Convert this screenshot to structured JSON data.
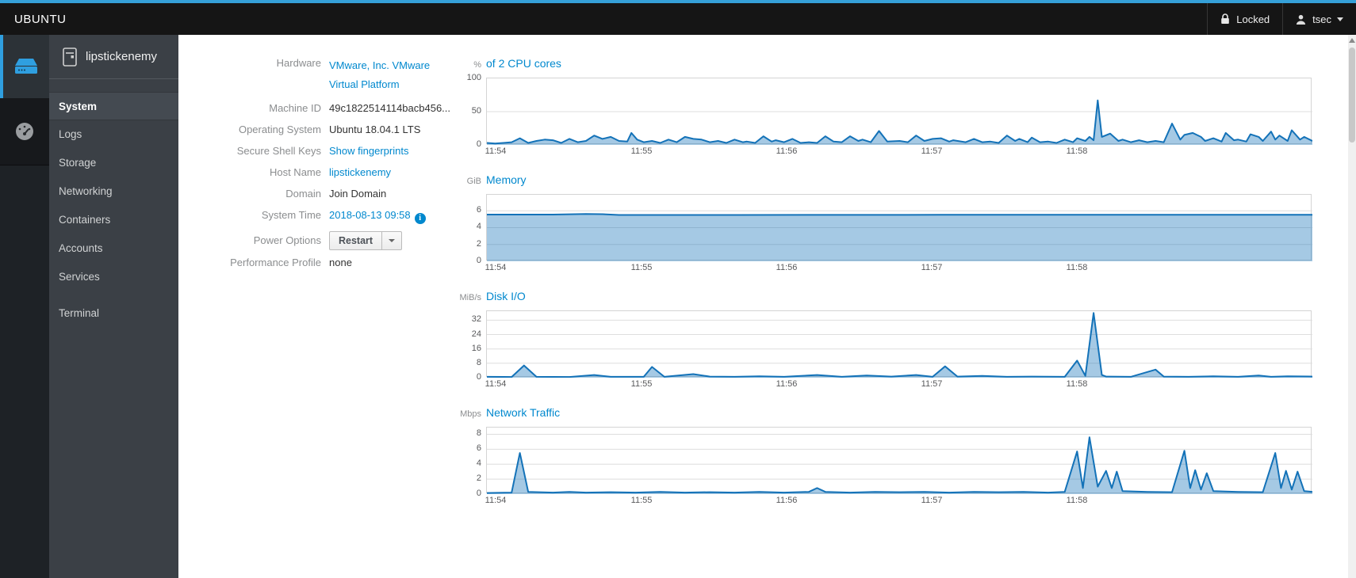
{
  "topbar": {
    "brand": "UBUNTU",
    "locked_label": "Locked",
    "user": "tsec"
  },
  "sidebar": {
    "host": "lipstickenemy",
    "items": [
      {
        "label": "System",
        "selected": true
      },
      {
        "label": "Logs",
        "selected": false
      },
      {
        "label": "Storage",
        "selected": false
      },
      {
        "label": "Networking",
        "selected": false
      },
      {
        "label": "Containers",
        "selected": false
      },
      {
        "label": "Accounts",
        "selected": false
      },
      {
        "label": "Services",
        "selected": false
      },
      {
        "label": "Terminal",
        "selected": false
      }
    ]
  },
  "info": {
    "hardware_label": "Hardware",
    "hardware_value": "VMware, Inc. VMware Virtual Platform",
    "machine_id_label": "Machine ID",
    "machine_id_value": "49c1822514114bacb456...",
    "os_label": "Operating System",
    "os_value": "Ubuntu 18.04.1 LTS",
    "ssh_label": "Secure Shell Keys",
    "ssh_value": "Show fingerprints",
    "hostname_label": "Host Name",
    "hostname_value": "lipstickenemy",
    "domain_label": "Domain",
    "domain_value": "Join Domain",
    "time_label": "System Time",
    "time_value": "2018-08-13 09:58",
    "power_label": "Power Options",
    "power_button": "Restart",
    "perf_label": "Performance Profile",
    "perf_value": "none"
  },
  "colors": {
    "accent_link": "#0088ce",
    "topbar_accent": "#35a0d8",
    "chart_line": "#1372b8",
    "chart_fill": "rgba(19,114,184,0.38)",
    "grid_line": "#dedede"
  },
  "chart_data": [
    {
      "type": "area",
      "title": "of 2 CPU cores",
      "unit": "%",
      "ylim": [
        0,
        100
      ],
      "yticks": [
        100,
        50,
        0
      ],
      "x_tick_labels": [
        "11:54",
        "11:55",
        "11:56",
        "11:57",
        "11:58"
      ],
      "x_tick_fracs": [
        0.012,
        0.188,
        0.364,
        0.54,
        0.716
      ],
      "grid": true,
      "legend": "none",
      "points": [
        [
          0,
          3
        ],
        [
          0.01,
          2
        ],
        [
          0.02,
          3
        ],
        [
          0.03,
          4
        ],
        [
          0.04,
          10
        ],
        [
          0.05,
          3
        ],
        [
          0.06,
          6
        ],
        [
          0.07,
          8
        ],
        [
          0.08,
          7
        ],
        [
          0.09,
          3
        ],
        [
          0.1,
          9
        ],
        [
          0.11,
          4
        ],
        [
          0.12,
          6
        ],
        [
          0.13,
          14
        ],
        [
          0.14,
          9
        ],
        [
          0.15,
          12
        ],
        [
          0.16,
          6
        ],
        [
          0.17,
          5
        ],
        [
          0.175,
          18
        ],
        [
          0.182,
          8
        ],
        [
          0.19,
          4
        ],
        [
          0.2,
          6
        ],
        [
          0.21,
          3
        ],
        [
          0.22,
          8
        ],
        [
          0.23,
          4
        ],
        [
          0.24,
          12
        ],
        [
          0.25,
          9
        ],
        [
          0.26,
          8
        ],
        [
          0.27,
          4
        ],
        [
          0.28,
          6
        ],
        [
          0.29,
          3
        ],
        [
          0.3,
          8
        ],
        [
          0.31,
          4
        ],
        [
          0.315,
          5
        ],
        [
          0.325,
          3
        ],
        [
          0.335,
          13
        ],
        [
          0.345,
          5
        ],
        [
          0.35,
          7
        ],
        [
          0.36,
          4
        ],
        [
          0.37,
          9
        ],
        [
          0.38,
          3
        ],
        [
          0.39,
          4
        ],
        [
          0.4,
          3
        ],
        [
          0.41,
          13
        ],
        [
          0.42,
          5
        ],
        [
          0.43,
          4
        ],
        [
          0.44,
          13
        ],
        [
          0.45,
          6
        ],
        [
          0.455,
          8
        ],
        [
          0.465,
          4
        ],
        [
          0.475,
          21
        ],
        [
          0.485,
          5
        ],
        [
          0.5,
          6
        ],
        [
          0.51,
          4
        ],
        [
          0.52,
          14
        ],
        [
          0.53,
          6
        ],
        [
          0.54,
          9
        ],
        [
          0.55,
          10
        ],
        [
          0.56,
          5
        ],
        [
          0.565,
          7
        ],
        [
          0.58,
          4
        ],
        [
          0.59,
          9
        ],
        [
          0.6,
          4
        ],
        [
          0.61,
          5
        ],
        [
          0.62,
          3
        ],
        [
          0.63,
          14
        ],
        [
          0.64,
          6
        ],
        [
          0.645,
          9
        ],
        [
          0.655,
          4
        ],
        [
          0.66,
          11
        ],
        [
          0.67,
          4
        ],
        [
          0.68,
          5
        ],
        [
          0.69,
          3
        ],
        [
          0.7,
          8
        ],
        [
          0.71,
          4
        ],
        [
          0.715,
          10
        ],
        [
          0.725,
          6
        ],
        [
          0.73,
          12
        ],
        [
          0.735,
          7
        ],
        [
          0.74,
          67
        ],
        [
          0.745,
          12
        ],
        [
          0.755,
          17
        ],
        [
          0.765,
          6
        ],
        [
          0.77,
          8
        ],
        [
          0.78,
          4
        ],
        [
          0.79,
          7
        ],
        [
          0.8,
          4
        ],
        [
          0.81,
          6
        ],
        [
          0.82,
          4
        ],
        [
          0.83,
          32
        ],
        [
          0.84,
          8
        ],
        [
          0.845,
          15
        ],
        [
          0.855,
          18
        ],
        [
          0.865,
          12
        ],
        [
          0.87,
          6
        ],
        [
          0.88,
          10
        ],
        [
          0.89,
          5
        ],
        [
          0.895,
          18
        ],
        [
          0.905,
          7
        ],
        [
          0.91,
          8
        ],
        [
          0.92,
          5
        ],
        [
          0.925,
          16
        ],
        [
          0.935,
          12
        ],
        [
          0.94,
          6
        ],
        [
          0.95,
          20
        ],
        [
          0.955,
          8
        ],
        [
          0.96,
          14
        ],
        [
          0.97,
          6
        ],
        [
          0.975,
          22
        ],
        [
          0.985,
          8
        ],
        [
          0.99,
          12
        ],
        [
          1,
          6
        ]
      ]
    },
    {
      "type": "area",
      "title": "Memory",
      "unit": "GiB",
      "ylim": [
        0,
        7.9
      ],
      "yticks": [
        6,
        4,
        2,
        0
      ],
      "x_tick_labels": [
        "11:54",
        "11:55",
        "11:56",
        "11:57",
        "11:58"
      ],
      "x_tick_fracs": [
        0.012,
        0.188,
        0.364,
        0.54,
        0.716
      ],
      "grid": true,
      "legend": "none",
      "points": [
        [
          0,
          5.55
        ],
        [
          0.08,
          5.55
        ],
        [
          0.12,
          5.62
        ],
        [
          0.14,
          5.6
        ],
        [
          0.16,
          5.5
        ],
        [
          0.3,
          5.5
        ],
        [
          0.55,
          5.52
        ],
        [
          0.8,
          5.53
        ],
        [
          1,
          5.53
        ]
      ]
    },
    {
      "type": "area",
      "title": "Disk I/O",
      "unit": "MiB/s",
      "ylim": [
        0,
        37
      ],
      "yticks": [
        32,
        24,
        16,
        8,
        0
      ],
      "x_tick_labels": [
        "11:54",
        "11:55",
        "11:56",
        "11:57",
        "11:58"
      ],
      "x_tick_fracs": [
        0.012,
        0.188,
        0.364,
        0.54,
        0.716
      ],
      "grid": true,
      "legend": "none",
      "points": [
        [
          0,
          0.5
        ],
        [
          0.03,
          0.4
        ],
        [
          0.045,
          6.8
        ],
        [
          0.06,
          0.5
        ],
        [
          0.1,
          0.4
        ],
        [
          0.13,
          1.5
        ],
        [
          0.15,
          0.5
        ],
        [
          0.19,
          0.5
        ],
        [
          0.2,
          6.0
        ],
        [
          0.215,
          0.5
        ],
        [
          0.25,
          2.0
        ],
        [
          0.27,
          0.6
        ],
        [
          0.3,
          0.5
        ],
        [
          0.33,
          0.8
        ],
        [
          0.36,
          0.5
        ],
        [
          0.4,
          1.5
        ],
        [
          0.43,
          0.5
        ],
        [
          0.46,
          1.2
        ],
        [
          0.49,
          0.6
        ],
        [
          0.52,
          1.5
        ],
        [
          0.54,
          0.5
        ],
        [
          0.555,
          6.3
        ],
        [
          0.57,
          0.6
        ],
        [
          0.6,
          1.0
        ],
        [
          0.63,
          0.5
        ],
        [
          0.66,
          0.6
        ],
        [
          0.7,
          0.5
        ],
        [
          0.715,
          9.5
        ],
        [
          0.725,
          1.0
        ],
        [
          0.735,
          36
        ],
        [
          0.745,
          1.5
        ],
        [
          0.75,
          0.6
        ],
        [
          0.78,
          0.5
        ],
        [
          0.81,
          4.5
        ],
        [
          0.82,
          0.6
        ],
        [
          0.85,
          0.5
        ],
        [
          0.88,
          0.8
        ],
        [
          0.91,
          0.5
        ],
        [
          0.935,
          1.2
        ],
        [
          0.95,
          0.5
        ],
        [
          0.97,
          0.8
        ],
        [
          1,
          0.6
        ]
      ]
    },
    {
      "type": "area",
      "title": "Network Traffic",
      "unit": "Mbps",
      "ylim": [
        0,
        8.9
      ],
      "yticks": [
        8,
        6,
        4,
        2,
        0
      ],
      "x_tick_labels": [
        "11:54",
        "11:55",
        "11:56",
        "11:57",
        "11:58"
      ],
      "x_tick_fracs": [
        0.012,
        0.188,
        0.364,
        0.54,
        0.716
      ],
      "grid": true,
      "legend": "none",
      "points": [
        [
          0,
          0.15
        ],
        [
          0.03,
          0.2
        ],
        [
          0.04,
          5.5
        ],
        [
          0.05,
          0.3
        ],
        [
          0.08,
          0.2
        ],
        [
          0.1,
          0.3
        ],
        [
          0.12,
          0.2
        ],
        [
          0.15,
          0.25
        ],
        [
          0.18,
          0.2
        ],
        [
          0.21,
          0.3
        ],
        [
          0.24,
          0.2
        ],
        [
          0.27,
          0.25
        ],
        [
          0.3,
          0.2
        ],
        [
          0.33,
          0.3
        ],
        [
          0.36,
          0.2
        ],
        [
          0.39,
          0.3
        ],
        [
          0.4,
          0.8
        ],
        [
          0.41,
          0.3
        ],
        [
          0.44,
          0.2
        ],
        [
          0.47,
          0.3
        ],
        [
          0.5,
          0.25
        ],
        [
          0.53,
          0.3
        ],
        [
          0.56,
          0.2
        ],
        [
          0.59,
          0.3
        ],
        [
          0.62,
          0.25
        ],
        [
          0.65,
          0.3
        ],
        [
          0.68,
          0.2
        ],
        [
          0.7,
          0.3
        ],
        [
          0.715,
          5.7
        ],
        [
          0.722,
          0.8
        ],
        [
          0.73,
          7.6
        ],
        [
          0.74,
          1.0
        ],
        [
          0.75,
          3.1
        ],
        [
          0.757,
          0.8
        ],
        [
          0.763,
          3.0
        ],
        [
          0.77,
          0.4
        ],
        [
          0.8,
          0.3
        ],
        [
          0.83,
          0.25
        ],
        [
          0.845,
          5.8
        ],
        [
          0.852,
          0.8
        ],
        [
          0.858,
          3.2
        ],
        [
          0.865,
          0.6
        ],
        [
          0.872,
          2.8
        ],
        [
          0.88,
          0.4
        ],
        [
          0.91,
          0.3
        ],
        [
          0.94,
          0.25
        ],
        [
          0.955,
          5.5
        ],
        [
          0.962,
          0.8
        ],
        [
          0.968,
          3.1
        ],
        [
          0.975,
          0.6
        ],
        [
          0.982,
          3.0
        ],
        [
          0.99,
          0.4
        ],
        [
          1,
          0.3
        ]
      ]
    }
  ]
}
